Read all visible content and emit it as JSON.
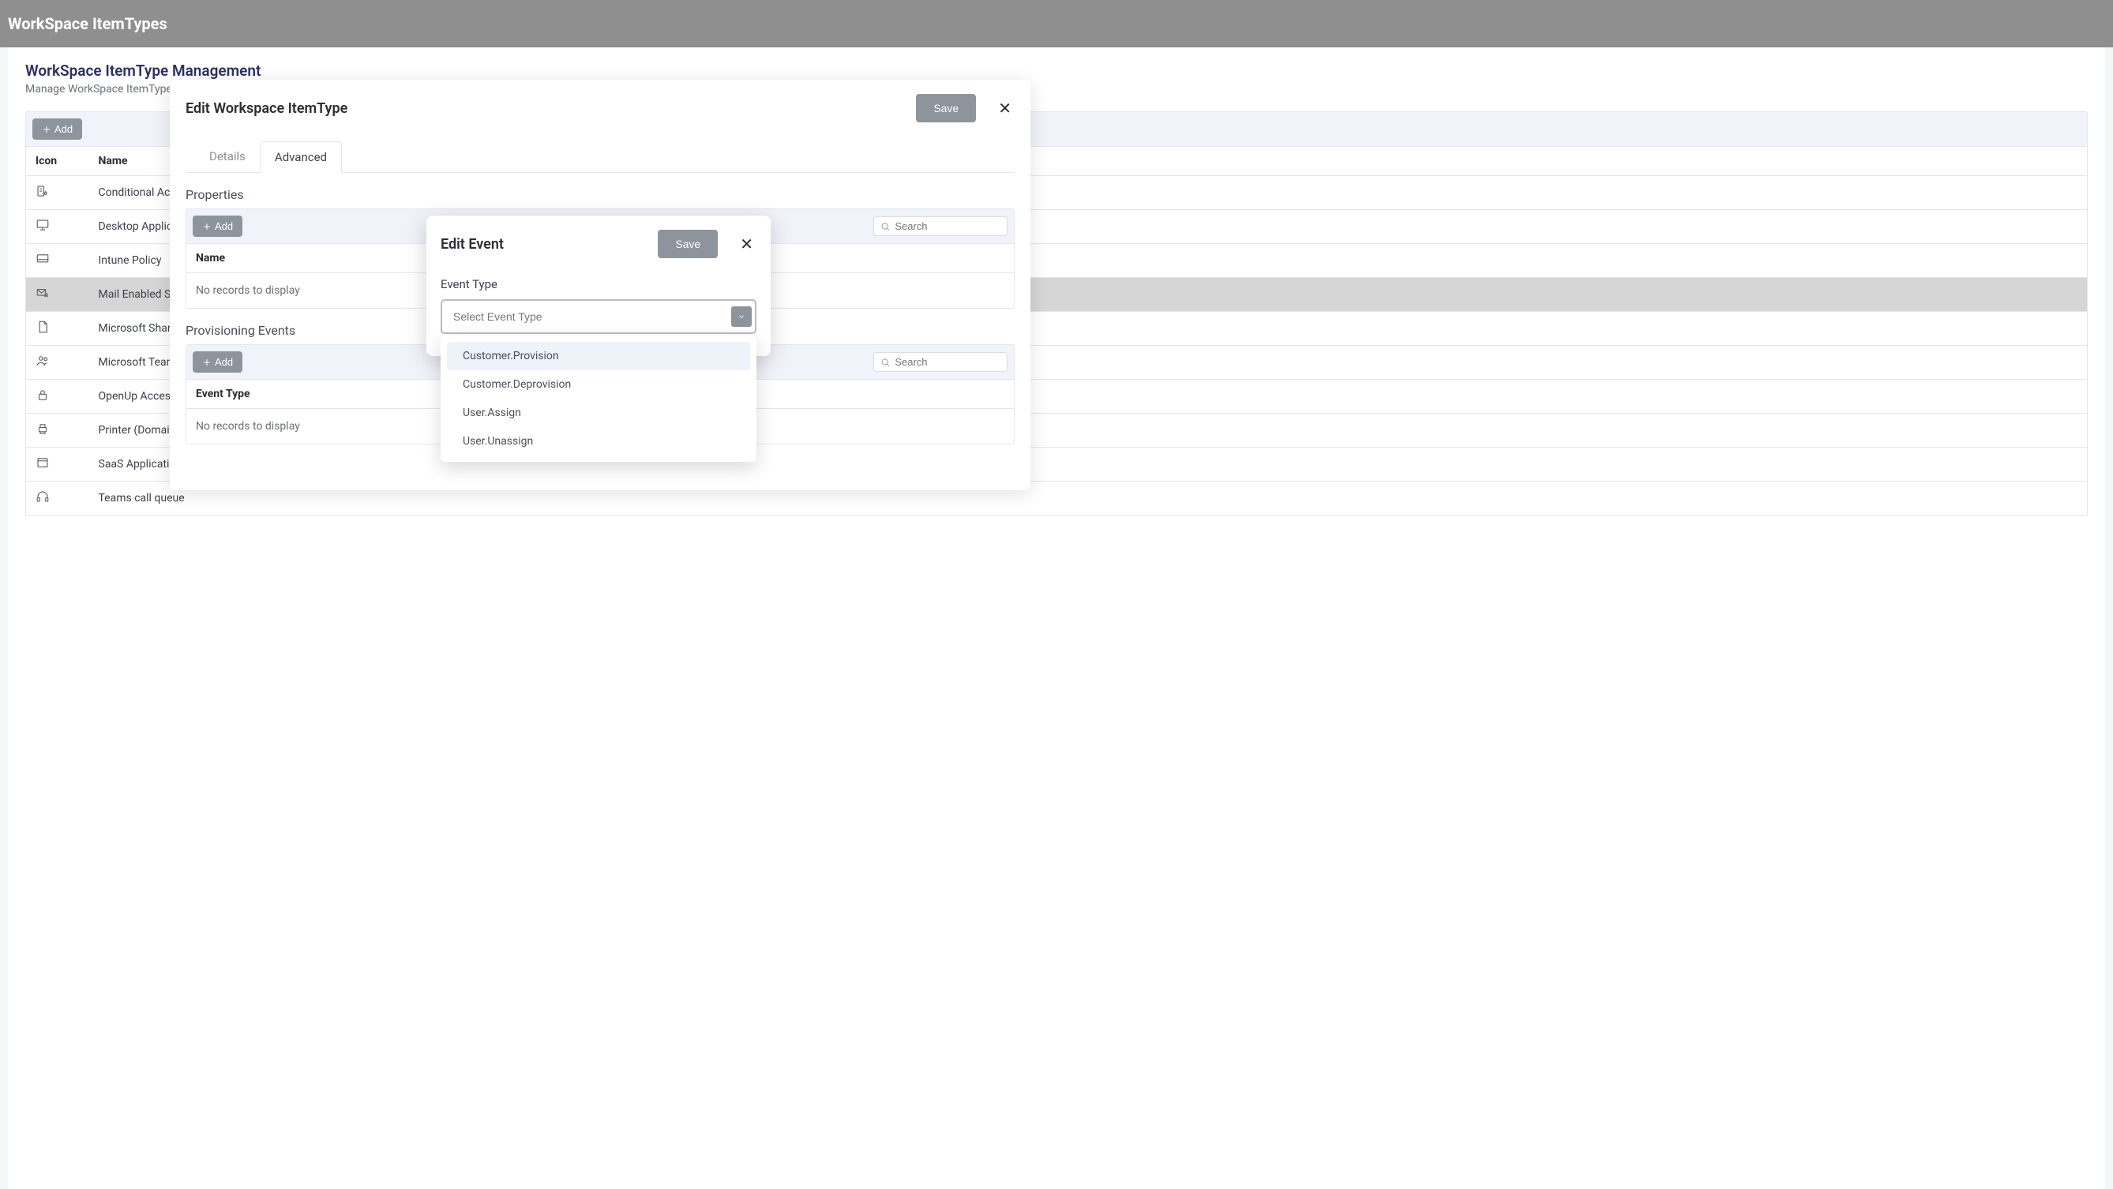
{
  "topbar": {
    "title": "WorkSpace ItemTypes"
  },
  "page": {
    "title": "WorkSpace ItemType Management",
    "subtitle": "Manage WorkSpace ItemTypes"
  },
  "main_table": {
    "add_label": "Add",
    "columns": {
      "icon": "Icon",
      "name": "Name"
    },
    "rows": [
      {
        "icon": "building-lock",
        "name": "Conditional Access"
      },
      {
        "icon": "desktop",
        "name": "Desktop Application"
      },
      {
        "icon": "monitor",
        "name": "Intune Policy"
      },
      {
        "icon": "mail-shield",
        "name": "Mail Enabled Securi",
        "highlighted": true
      },
      {
        "icon": "file",
        "name": "Microsoft SharePoin"
      },
      {
        "icon": "users",
        "name": "Microsoft Teams Tea"
      },
      {
        "icon": "lock",
        "name": "OpenUp Access Co"
      },
      {
        "icon": "printer",
        "name": "Printer (Domain)"
      },
      {
        "icon": "window",
        "name": "SaaS Application (A"
      },
      {
        "icon": "headset",
        "name": "Teams call queue"
      }
    ]
  },
  "edit_modal": {
    "title": "Edit Workspace ItemType",
    "save_label": "Save",
    "tabs": [
      {
        "key": "details",
        "label": "Details",
        "active": false
      },
      {
        "key": "advanced",
        "label": "Advanced",
        "active": true
      }
    ],
    "properties": {
      "title": "Properties",
      "add_label": "Add",
      "search_placeholder": "Search",
      "column": "Name",
      "empty": "No records to display"
    },
    "events": {
      "title": "Provisioning Events",
      "add_label": "Add",
      "search_placeholder": "Search",
      "column": "Event Type",
      "empty": "No records to display"
    }
  },
  "event_modal": {
    "title": "Edit Event",
    "save_label": "Save",
    "field_label": "Event Type",
    "placeholder": "Select Event Type",
    "options": [
      "Customer.Provision",
      "Customer.Deprovision",
      "User.Assign",
      "User.Unassign"
    ]
  }
}
